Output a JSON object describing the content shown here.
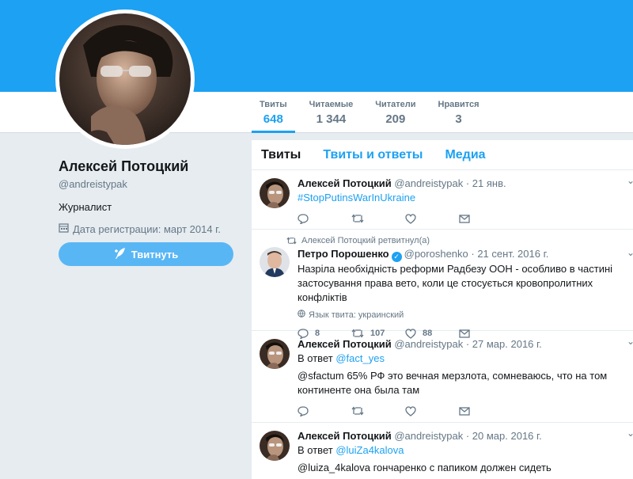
{
  "profile": {
    "name": "Алексей Потоцкий",
    "handle": "@andreistypak",
    "bio": "Журналист",
    "joined": "Дата регистрации: март 2014 г.",
    "tweet_button": "Твитнуть"
  },
  "stats": [
    {
      "label": "Твиты",
      "value": "648",
      "active": true
    },
    {
      "label": "Читаемые",
      "value": "1 344"
    },
    {
      "label": "Читатели",
      "value": "209"
    },
    {
      "label": "Нравится",
      "value": "3"
    }
  ],
  "tabs": [
    "Твиты",
    "Твиты и ответы",
    "Медиа"
  ],
  "tweets": [
    {
      "name": "Алексей Потоцкий",
      "handle": "@andreistypak",
      "date": "· 21 янв.",
      "link": "#StopPutinsWarInUkraine"
    },
    {
      "retweeted_by": "Алексей Потоцкий ретвитнул(а)",
      "name": "Петро Порошенко",
      "handle": "@poroshenko",
      "date": "· 21 сент. 2016 г.",
      "text": "Назріла необхідність реформи Радбезу ООН - особливо в частині застосування права вето, коли це стосується кровопролитних конфліктів",
      "lang": "Язык твита: украинский",
      "replies": "8",
      "retweets": "107",
      "likes": "88"
    },
    {
      "name": "Алексей Потоцкий",
      "handle": "@andreistypak",
      "date": "· 27 мар. 2016 г.",
      "reply_prefix": "В ответ",
      "reply_to": "@fact_yes",
      "text": "@sfactum 65% РФ это вечная мерзлота, сомневаюсь, что на том континенте она была там"
    },
    {
      "name": "Алексей Потоцкий",
      "handle": "@andreistypak",
      "date": "· 20 мар. 2016 г.",
      "reply_prefix": "В ответ",
      "reply_to": "@luiZa4kalova",
      "text": "@luiza_4kalova гончаренко с папиком должен сидеть"
    }
  ],
  "colors": {
    "accent": "#1da1f2",
    "header": "#1da1f2",
    "button": "#59b6f5",
    "bg": "#e6ecf0",
    "muted": "#657786"
  }
}
